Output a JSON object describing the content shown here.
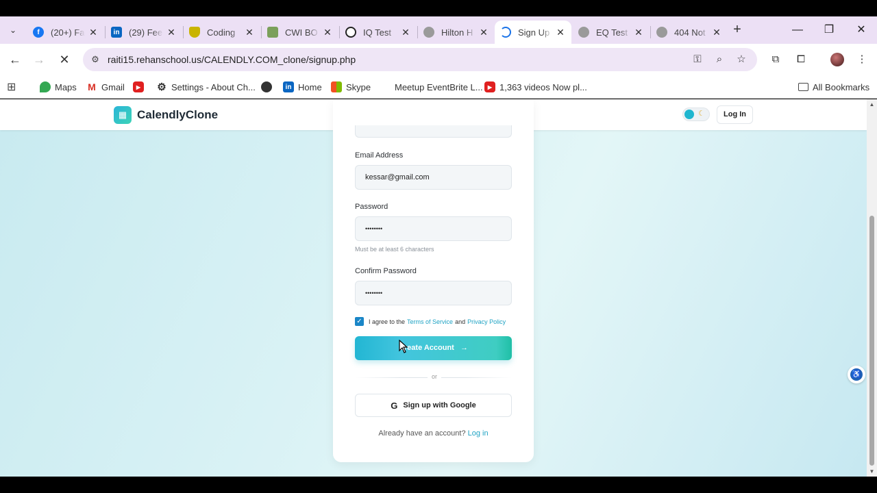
{
  "browser": {
    "tabs": [
      {
        "title": "(20+) Fa",
        "icon": "facebook-icon",
        "color": "#1877f2"
      },
      {
        "title": "(29) Fee",
        "icon": "linkedin-icon",
        "color": "#0a66c2"
      },
      {
        "title": "Coding",
        "icon": "shield-icon",
        "color": "#c9b400"
      },
      {
        "title": "CWI BO",
        "icon": "certificate-icon",
        "color": "#7ba05b"
      },
      {
        "title": "IQ Test",
        "icon": "openai-icon",
        "color": "#222222"
      },
      {
        "title": "Hilton H",
        "icon": "globe-icon",
        "color": "#8a8a8a"
      },
      {
        "title": "Sign Up",
        "icon": "loading-icon",
        "color": "#1a73e8",
        "active": true
      },
      {
        "title": "EQ Test",
        "icon": "globe-icon",
        "color": "#8a8a8a"
      },
      {
        "title": "404 Not",
        "icon": "globe-icon",
        "color": "#8a8a8a"
      }
    ],
    "url": "raiti15.rehanschool.us/CALENDLY.COM_clone/signup.php",
    "bookmarks": [
      {
        "label": "",
        "icon": "apps-grid-icon"
      },
      {
        "label": "Maps",
        "icon": "maps-pin-icon"
      },
      {
        "label": "Gmail",
        "icon": "gmail-icon"
      },
      {
        "label": "",
        "icon": "youtube-icon"
      },
      {
        "label": "Settings - About Ch...",
        "icon": "gear-icon"
      },
      {
        "label": "",
        "icon": "globe-icon"
      },
      {
        "label": "Home",
        "icon": "linkedin-icon"
      },
      {
        "label": "Skype",
        "icon": "windows-icon"
      },
      {
        "label": "Meetup EventBrite L...",
        "icon": ""
      },
      {
        "label": "1,363 videos Now pl...",
        "icon": "youtube-icon"
      }
    ],
    "all_bookmarks": "All Bookmarks"
  },
  "site": {
    "brand": "CalendlyClone",
    "login_button": "Log In"
  },
  "form": {
    "email_label": "Email Address",
    "email_value": "kessar@gmail.com",
    "password_label": "Password",
    "password_value": "••••••••",
    "password_hint": "Must be at least 6 characters",
    "confirm_label": "Confirm Password",
    "confirm_value": "••••••••",
    "agree_prefix": "I agree to the",
    "terms_link": "Terms of Service",
    "agree_and": "and",
    "privacy_link": "Privacy Policy",
    "agree_checked": true,
    "create_button": "Create Account",
    "or_text": "or",
    "google_button": "Sign up with Google",
    "already_text": "Already have an account?",
    "login_link": "Log in"
  },
  "colors": {
    "accent": "#1fb6cf",
    "link": "#1fa3c4",
    "tab_strip": "#ece0f5"
  }
}
